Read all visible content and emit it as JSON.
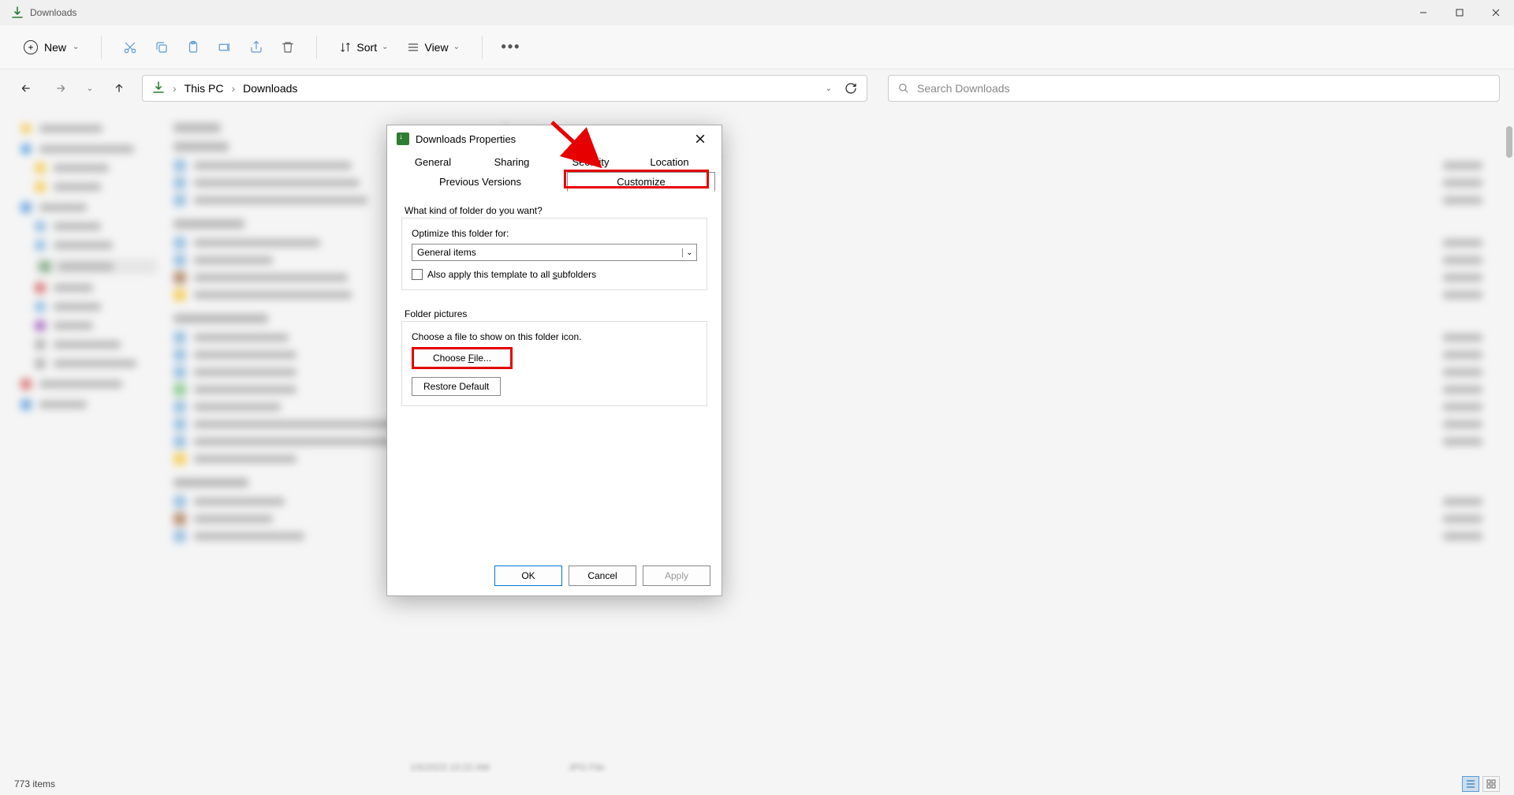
{
  "window": {
    "title": "Downloads",
    "minimize": "–",
    "maximize": "❐",
    "close": "✕"
  },
  "toolbar": {
    "new": "New",
    "sort": "Sort",
    "view": "View",
    "more": "…"
  },
  "breadcrumb": {
    "root": "This PC",
    "current": "Downloads",
    "sep": "›"
  },
  "search": {
    "placeholder": "Search Downloads"
  },
  "dialog": {
    "title": "Downloads Properties",
    "tabs": {
      "general": "General",
      "sharing": "Sharing",
      "security": "Security",
      "location": "Location",
      "previous": "Previous Versions",
      "customize": "Customize"
    },
    "section1": {
      "q": "What kind of folder do you want?",
      "optimize": "Optimize this folder for:",
      "combo_value": "General items",
      "also_apply": "Also apply this template to all subfolders"
    },
    "section2": {
      "title": "Folder pictures",
      "choose_msg": "Choose a file to show on this folder icon.",
      "choose_file": "Choose File...",
      "restore": "Restore Default"
    },
    "buttons": {
      "ok": "OK",
      "cancel": "Cancel",
      "apply": "Apply"
    }
  },
  "status": {
    "items": "773 items"
  },
  "bg": {
    "date": "1/5/2023 10:22 AM",
    "type": "JPG File"
  }
}
